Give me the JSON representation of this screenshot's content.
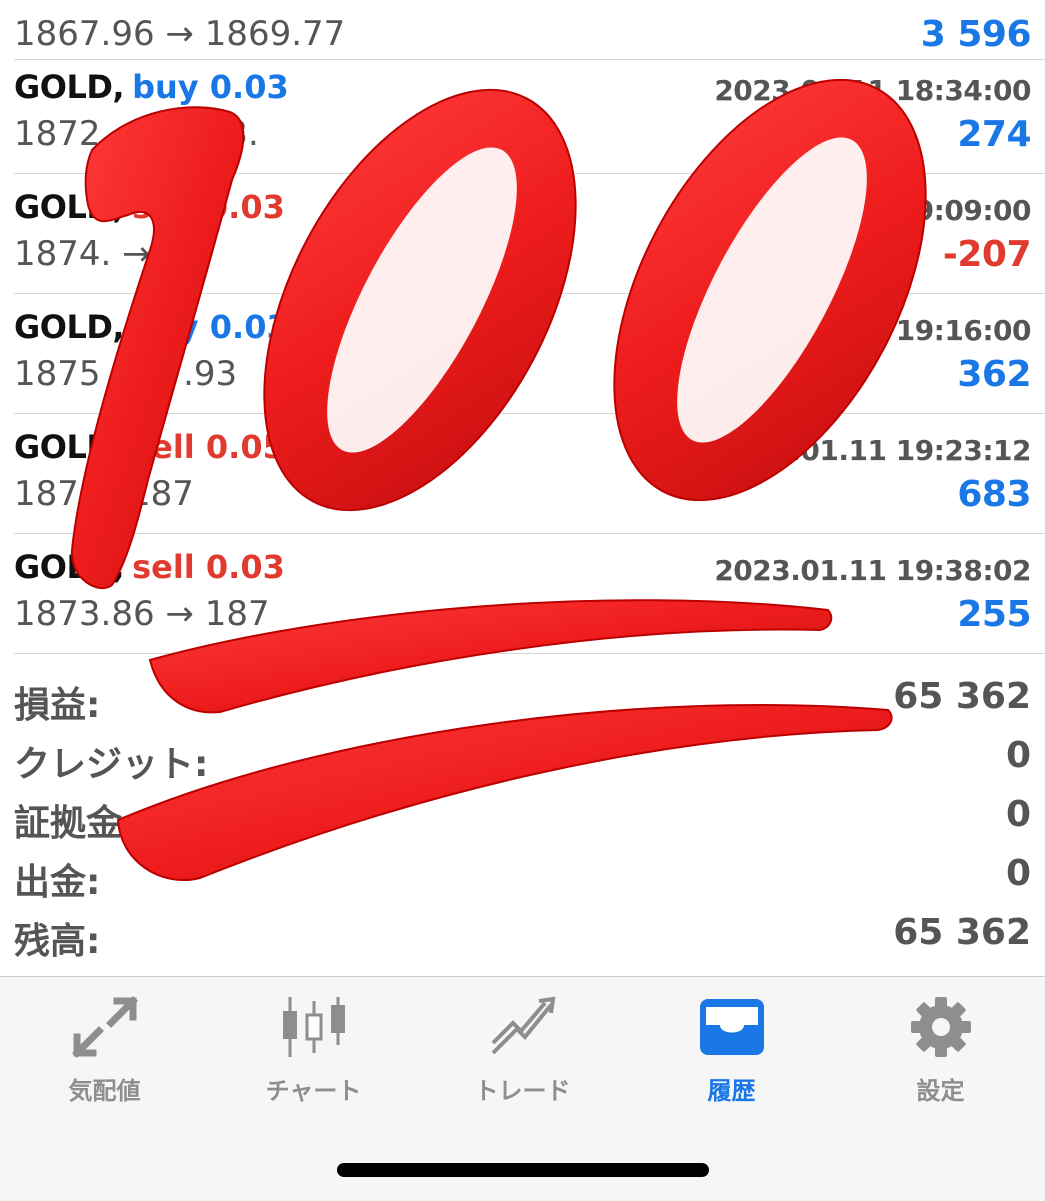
{
  "trades": [
    {
      "symbol": "",
      "side_label": "",
      "side_type": "buy",
      "time": "",
      "prices": "1867.96 → 1869.77",
      "profit": "3 596",
      "profit_sign": "pos"
    },
    {
      "symbol": "GOLD,",
      "side_label": "buy 0.03",
      "side_type": "buy",
      "time": "2023.01.11 18:34:00",
      "prices": "1872.   → 1873.",
      "profit": "274",
      "profit_sign": "pos"
    },
    {
      "symbol": "GOLD,",
      "side_label": "sell 0.03",
      "side_type": "sell",
      "time": "2023.01.11 19:09:00",
      "prices": "1874.   → 18",
      "profit": "-207",
      "profit_sign": "neg"
    },
    {
      "symbol": "GOLD,",
      "side_label": "buy 0.03",
      "side_type": "buy",
      "time": "2023.01.11 19:16:00",
      "prices": "1875   → 1  .93",
      "profit": "362",
      "profit_sign": "pos"
    },
    {
      "symbol": "GOLD,",
      "side_label": "sell 0.05",
      "side_type": "sell",
      "time": "2023.01.11 19:23:12",
      "prices": "187   → 187",
      "profit": "683",
      "profit_sign": "pos"
    },
    {
      "symbol": "GOLD,",
      "side_label": "sell 0.03",
      "side_type": "sell",
      "time": "2023.01.11 19:38:02",
      "prices": "1873.86 → 187",
      "profit": "255",
      "profit_sign": "pos"
    }
  ],
  "summary": [
    {
      "label": "損益:",
      "value": "65 362"
    },
    {
      "label": "クレジット:",
      "value": "0"
    },
    {
      "label": "証拠金:",
      "value": "0"
    },
    {
      "label": "出金:",
      "value": "0"
    },
    {
      "label": "残高:",
      "value": "65 362"
    }
  ],
  "tabs": [
    {
      "label": "気配値",
      "icon": "quotes-arrows-icon",
      "active": false
    },
    {
      "label": "チャート",
      "icon": "candlestick-chart-icon",
      "active": false
    },
    {
      "label": "トレード",
      "icon": "trade-trend-icon",
      "active": false
    },
    {
      "label": "履歴",
      "icon": "history-inbox-icon",
      "active": true
    },
    {
      "label": "設定",
      "icon": "settings-gear-icon",
      "active": false
    }
  ],
  "overlay": {
    "emoji": "hundred-points-emoji"
  },
  "colors": {
    "blue": "#1a78e6",
    "red": "#e03b2e",
    "gray": "#555555",
    "tab_inactive": "#8e8e8e",
    "emoji_red": "#ee1c1c"
  }
}
